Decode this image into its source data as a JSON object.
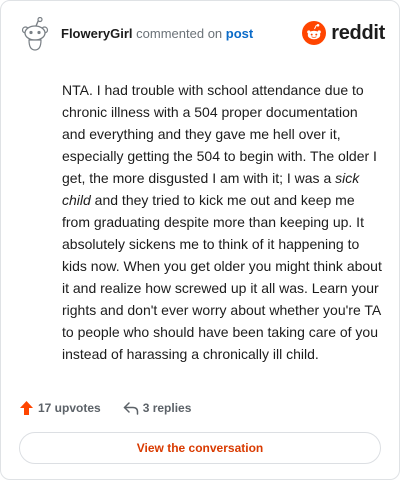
{
  "header": {
    "username": "FloweryGirl",
    "action_text": "commented on",
    "post_link": "post",
    "brand_name": "reddit",
    "brand_color": "#ff4500"
  },
  "comment": {
    "part1": "NTA. I had trouble with school attendance due to chronic illness with a 504 proper documentation and everything and they gave me hell over it, especially getting the 504 to begin with. The older I get, the more disgusted I am with it; I was a ",
    "emphasis": "sick child",
    "part2": " and they tried to kick me out and keep me from graduating despite more than keeping up. It absolutely sickens me to think of it happening to kids now. When you get older you might think about it and realize how screwed up it all was. Learn your rights and don't ever worry about whether you're TA to people who should have been taking care of you instead of harassing a chronically ill child."
  },
  "actions": {
    "upvotes_label": "17 upvotes",
    "replies_label": "3 replies"
  },
  "cta": {
    "label": "View the conversation",
    "color": "#d93a00"
  },
  "icons": {
    "avatar": "snoo-avatar-icon",
    "brand": "reddit-logo-icon",
    "upvote": "upvote-arrow-icon",
    "reply": "reply-arrow-icon"
  }
}
